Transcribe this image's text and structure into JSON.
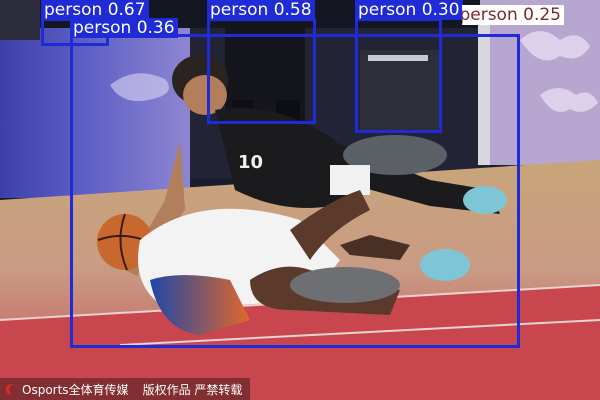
{
  "detections": [
    {
      "label": "person",
      "score": "0.67"
    },
    {
      "label": "person",
      "score": "0.36"
    },
    {
      "label": "person",
      "score": "0.58"
    },
    {
      "label": "person",
      "score": "0.30"
    },
    {
      "label": "person",
      "score": "0.25"
    }
  ],
  "box_color": "#1f2bd6",
  "watermark": {
    "logo_icon": "osports-logo-icon",
    "brand": "Osports全体育传媒",
    "rights": "版权作品 严禁转载"
  }
}
